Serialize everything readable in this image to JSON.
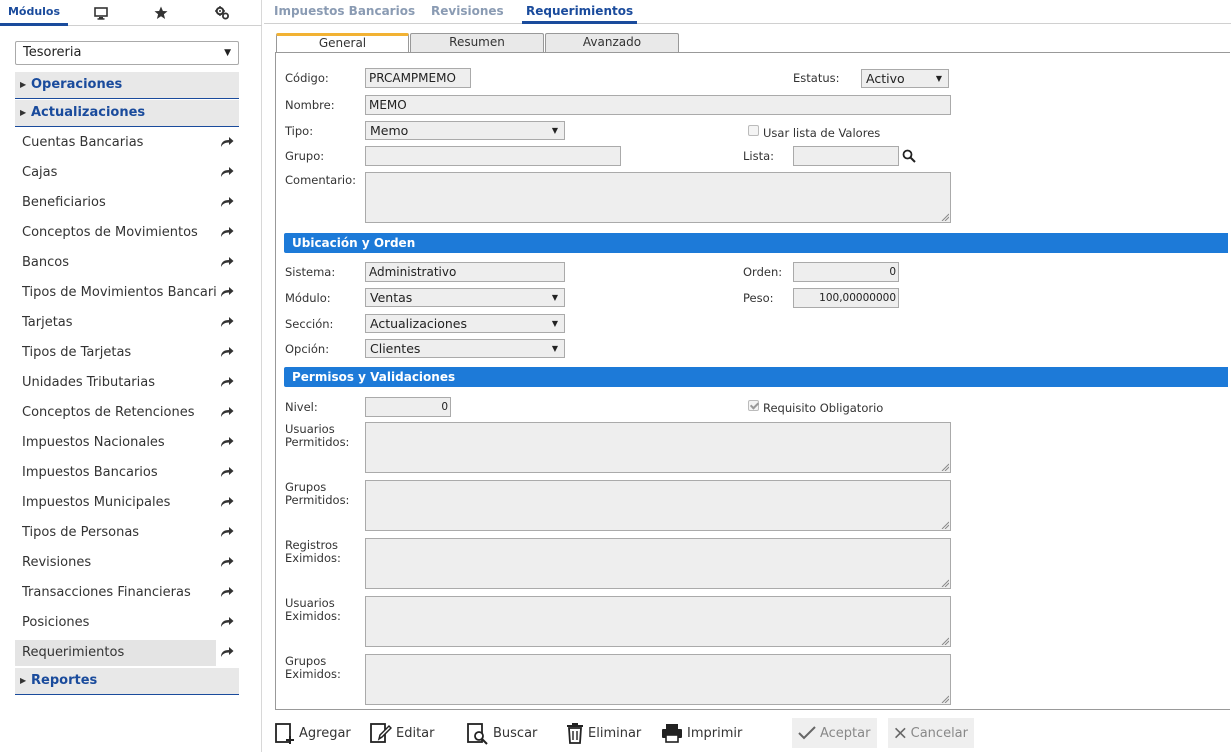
{
  "sidebar": {
    "tabs": {
      "modules_label": "Módulos"
    },
    "module_select": {
      "value": "Tesoreria"
    },
    "sections": {
      "operaciones": "Operaciones",
      "actualizaciones": "Actualizaciones",
      "reportes": "Reportes"
    },
    "items": [
      {
        "label": "Cuentas Bancarias"
      },
      {
        "label": "Cajas"
      },
      {
        "label": "Beneficiarios"
      },
      {
        "label": "Conceptos de Movimientos"
      },
      {
        "label": "Bancos"
      },
      {
        "label": "Tipos de Movimientos Bancari"
      },
      {
        "label": "Tarjetas"
      },
      {
        "label": "Tipos de Tarjetas"
      },
      {
        "label": "Unidades Tributarias"
      },
      {
        "label": "Conceptos de Retenciones"
      },
      {
        "label": "Impuestos Nacionales"
      },
      {
        "label": "Impuestos Bancarios"
      },
      {
        "label": "Impuestos Municipales"
      },
      {
        "label": "Tipos de Personas"
      },
      {
        "label": "Revisiones"
      },
      {
        "label": "Transacciones Financieras"
      },
      {
        "label": "Posiciones"
      },
      {
        "label": "Requerimientos"
      }
    ],
    "selected_item": "Requerimientos"
  },
  "top_tabs": [
    {
      "label": "Impuestos Bancarios"
    },
    {
      "label": "Revisiones"
    },
    {
      "label": "Requerimientos",
      "active": true
    }
  ],
  "sub_tabs": [
    {
      "label": "General",
      "active": true
    },
    {
      "label": "Resumen"
    },
    {
      "label": "Avanzado"
    }
  ],
  "form": {
    "codigo": {
      "label": "Código:",
      "value": "PRCAMPMEMO"
    },
    "estatus": {
      "label": "Estatus:",
      "value": "Activo"
    },
    "nombre": {
      "label": "Nombre:",
      "value": "MEMO"
    },
    "tipo": {
      "label": "Tipo:",
      "value": "Memo"
    },
    "usar_lista": {
      "label": "Usar lista de Valores",
      "checked": false
    },
    "grupo": {
      "label": "Grupo:",
      "value": ""
    },
    "lista": {
      "label": "Lista:",
      "value": ""
    },
    "comentario": {
      "label": "Comentario:",
      "value": ""
    }
  },
  "ubicacion": {
    "title": "Ubicación y Orden",
    "sistema": {
      "label": "Sistema:",
      "value": "Administrativo"
    },
    "orden": {
      "label": "Orden:",
      "value": "0"
    },
    "modulo": {
      "label": "Módulo:",
      "value": "Ventas"
    },
    "peso": {
      "label": "Peso:",
      "value": "100,00000000"
    },
    "seccion": {
      "label": "Sección:",
      "value": "Actualizaciones"
    },
    "opcion": {
      "label": "Opción:",
      "value": "Clientes"
    }
  },
  "permisos": {
    "title": "Permisos y Validaciones",
    "nivel": {
      "label": "Nivel:",
      "value": "0"
    },
    "requisito": {
      "label": "Requisito Obligatorio",
      "checked": true
    },
    "usuarios_permitidos": {
      "label1": "Usuarios",
      "label2": "Permitidos:"
    },
    "grupos_permitidos": {
      "label1": "Grupos",
      "label2": "Permitidos:"
    },
    "registros_eximidos": {
      "label1": "Registros",
      "label2": "Eximidos:"
    },
    "usuarios_eximidos": {
      "label1": "Usuarios",
      "label2": "Eximidos:"
    },
    "grupos_eximidos": {
      "label1": "Grupos",
      "label2": "Eximidos:"
    }
  },
  "toolbar": {
    "agregar": "Agregar",
    "editar": "Editar",
    "buscar": "Buscar",
    "eliminar": "Eliminar",
    "imprimir": "Imprimir",
    "aceptar": "Aceptar",
    "cancelar": "Cancelar"
  },
  "colors": {
    "accent": "#1a4b9c",
    "band": "#1d7ad8",
    "active_subtab": "#f2b233"
  }
}
